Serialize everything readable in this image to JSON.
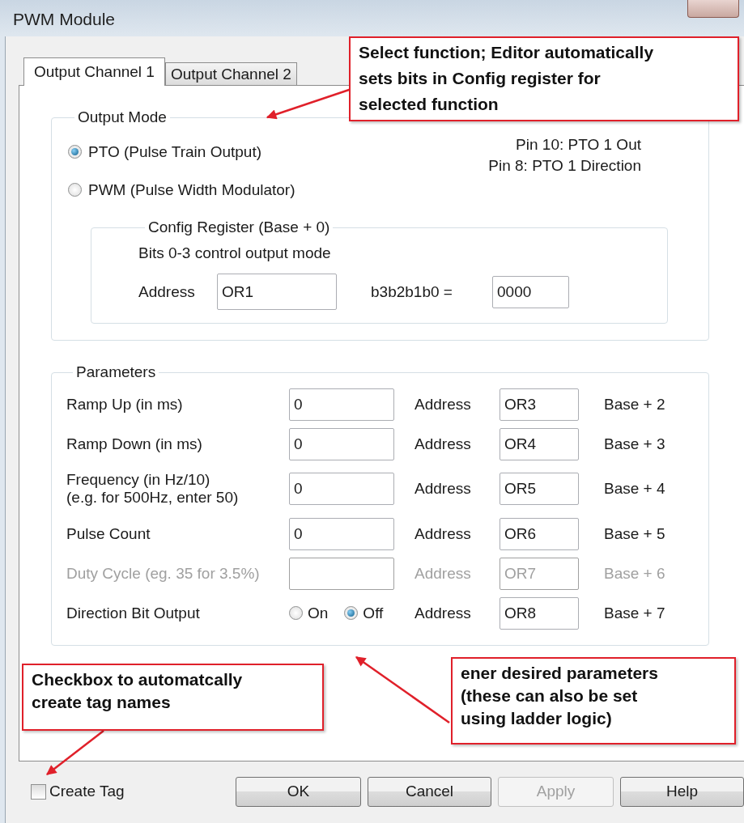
{
  "window": {
    "title": "PWM Module"
  },
  "tabs": [
    {
      "label": "Output Channel 1",
      "selected": true
    },
    {
      "label": "Output Channel 2",
      "selected": false
    }
  ],
  "output_mode": {
    "title": "Output Mode",
    "options": [
      {
        "label": "PTO (Pulse Train Output)",
        "selected": true
      },
      {
        "label": "PWM (Pulse Width Modulator)",
        "selected": false
      }
    ],
    "pin_notes": [
      "Pin 10: PTO 1 Out",
      "Pin 8: PTO 1 Direction"
    ],
    "config_register": {
      "title": "Config Register (Base + 0)",
      "description": "Bits 0-3 control output mode",
      "address_label": "Address",
      "address": "OR1",
      "bits_label": "b3b2b1b0 =",
      "bits": "0000"
    }
  },
  "parameters": {
    "title": "Parameters",
    "rows": [
      {
        "kind": "input",
        "label": "Ramp Up (in ms)",
        "value": "0",
        "address_label": "Address",
        "address": "OR3",
        "offset": "Base + 2",
        "disabled": false
      },
      {
        "kind": "input",
        "label": "Ramp Down (in ms)",
        "value": "0",
        "address_label": "Address",
        "address": "OR4",
        "offset": "Base + 3",
        "disabled": false
      },
      {
        "kind": "input",
        "label": "Frequency (in Hz/10)\n(e.g. for 500Hz, enter 50)",
        "value": "0",
        "address_label": "Address",
        "address": "OR5",
        "offset": "Base + 4",
        "disabled": false
      },
      {
        "kind": "input",
        "label": "Pulse Count",
        "value": "0",
        "address_label": "Address",
        "address": "OR6",
        "offset": "Base + 5",
        "disabled": false
      },
      {
        "kind": "input",
        "label": "Duty Cycle (eg. 35 for 3.5%)",
        "address_label": "Address",
        "address": "OR7",
        "offset": "Base + 6",
        "disabled": true
      },
      {
        "kind": "radio",
        "label": "Direction Bit Output",
        "options": [
          {
            "label": "On",
            "selected": false
          },
          {
            "label": "Off",
            "selected": true
          }
        ],
        "address_label": "Address",
        "address": "OR8",
        "offset": "Base + 7",
        "disabled": false
      }
    ]
  },
  "create_tag": {
    "label": "Create Tag",
    "checked": false
  },
  "buttons": [
    {
      "label": "OK",
      "disabled": false
    },
    {
      "label": "Cancel",
      "disabled": false
    },
    {
      "label": "Apply",
      "disabled": true
    },
    {
      "label": "Help",
      "disabled": false
    }
  ],
  "callouts": [
    {
      "text": "Select function; Editor automatically\nsets bits in Config register for\nselected function"
    },
    {
      "text": "Checkbox to automatcally\ncreate tag names"
    },
    {
      "text": "ener desired parameters\n(these can also be set\nusing ladder logic)"
    }
  ]
}
